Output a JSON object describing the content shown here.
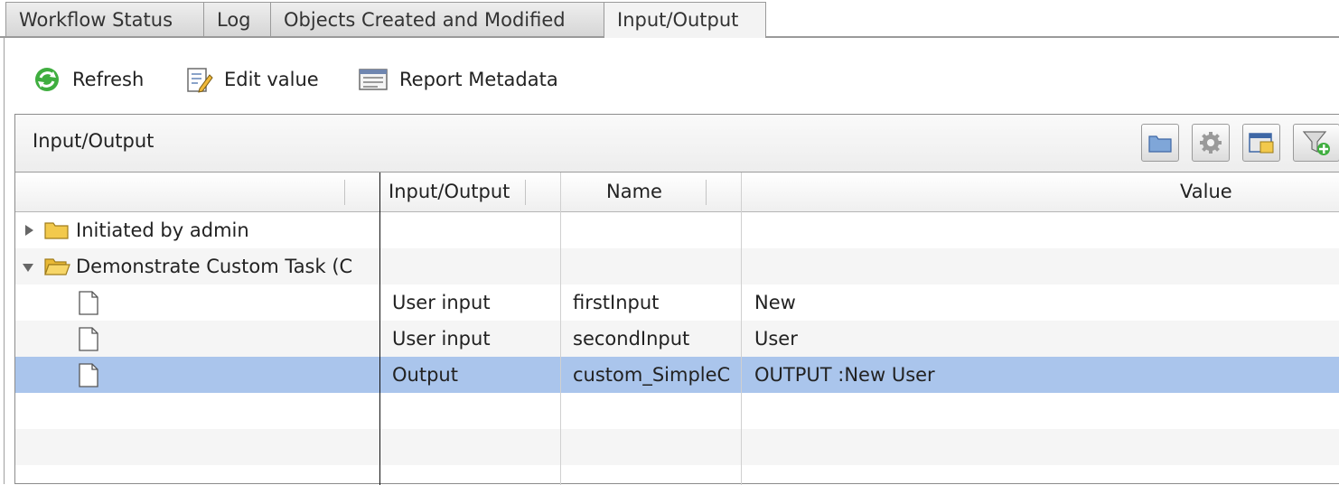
{
  "tabs": [
    {
      "label": "Workflow Status",
      "active": false
    },
    {
      "label": "Log",
      "active": false
    },
    {
      "label": "Objects Created and Modified",
      "active": false
    },
    {
      "label": "Input/Output",
      "active": true
    }
  ],
  "toolbar": {
    "refresh_label": "Refresh",
    "edit_value_label": "Edit value",
    "report_metadata_label": "Report Metadata"
  },
  "grid": {
    "title": "Input/Output",
    "columns": [
      "Input/Output",
      "Name",
      "Value"
    ],
    "rows": [
      {
        "tree": "Initiated by admin",
        "io": "",
        "name": "",
        "value": "",
        "expanded": false
      },
      {
        "tree": "Demonstrate Custom Task (C",
        "io": "",
        "name": "",
        "value": "",
        "expanded": true
      },
      {
        "tree": "",
        "io": "User input",
        "name": "firstInput",
        "value": "New"
      },
      {
        "tree": "",
        "io": "User input",
        "name": "secondInput",
        "value": "User"
      },
      {
        "tree": "",
        "io": "Output",
        "name": "custom_SimpleC",
        "value": "OUTPUT :New User",
        "selected": true
      }
    ]
  },
  "colors": {
    "selected_row": "#aac5ec",
    "folder": "#f2c94c"
  }
}
